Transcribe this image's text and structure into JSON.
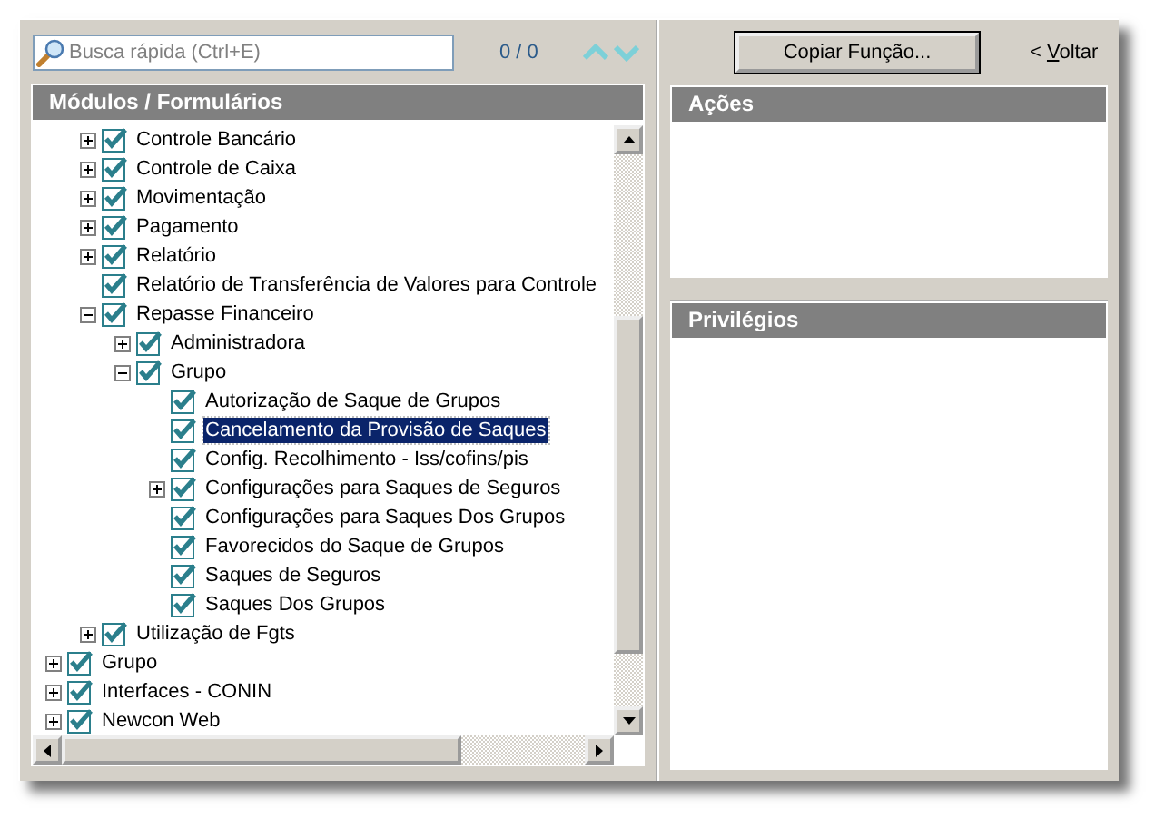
{
  "search": {
    "placeholder": "Busca rápida (Ctrl+E)",
    "count": "0 / 0"
  },
  "toolbar": {
    "copy_button": "Copiar Função...",
    "back_link": {
      "prefix": "< ",
      "mnemonic": "V",
      "rest": "oltar"
    }
  },
  "modules_panel": {
    "title": "Módulos / Formulários",
    "continued_items": [
      {
        "label": "Controle Bancário",
        "expanded": false,
        "checked": true,
        "selected": false
      },
      {
        "label": "Controle de Caixa",
        "expanded": false,
        "checked": true,
        "selected": false
      },
      {
        "label": "Movimentação",
        "expanded": false,
        "checked": true,
        "selected": false
      },
      {
        "label": "Pagamento",
        "expanded": false,
        "checked": true,
        "selected": false
      },
      {
        "label": "Relatório",
        "expanded": false,
        "checked": true,
        "selected": false
      },
      {
        "label": "Relatório de Transferência de Valores para Controle",
        "checked": true,
        "selected": false
      },
      {
        "label": "Repasse Financeiro",
        "expanded": true,
        "checked": true,
        "selected": false,
        "children": [
          {
            "label": "Administradora",
            "expanded": false,
            "checked": true,
            "selected": false
          },
          {
            "label": "Grupo",
            "expanded": true,
            "checked": true,
            "selected": false,
            "children": [
              {
                "label": "Autorização de Saque de Grupos",
                "checked": true,
                "selected": false
              },
              {
                "label": "Cancelamento da Provisão de Saques",
                "checked": true,
                "selected": true
              },
              {
                "label": "Config. Recolhimento - Iss/cofins/pis",
                "checked": true,
                "selected": false
              },
              {
                "label": "Configurações para Saques de Seguros",
                "expanded": false,
                "checked": true,
                "selected": false
              },
              {
                "label": "Configurações para Saques Dos Grupos",
                "checked": true,
                "selected": false
              },
              {
                "label": "Favorecidos do Saque de Grupos",
                "checked": true,
                "selected": false
              },
              {
                "label": "Saques de Seguros",
                "checked": true,
                "selected": false
              },
              {
                "label": "Saques Dos Grupos",
                "checked": true,
                "selected": false
              }
            ]
          }
        ]
      },
      {
        "label": "Utilização de Fgts",
        "expanded": false,
        "checked": true,
        "selected": false
      }
    ],
    "items": [
      {
        "label": "Grupo",
        "expanded": false,
        "checked": true,
        "selected": false
      },
      {
        "label": "Interfaces - CONIN",
        "expanded": false,
        "checked": true,
        "selected": false
      },
      {
        "label": "Newcon Web",
        "expanded": false,
        "checked": true,
        "selected": false
      }
    ]
  },
  "actions_panel": {
    "title": "Ações"
  },
  "privileges_panel": {
    "title": "Privilégios"
  }
}
